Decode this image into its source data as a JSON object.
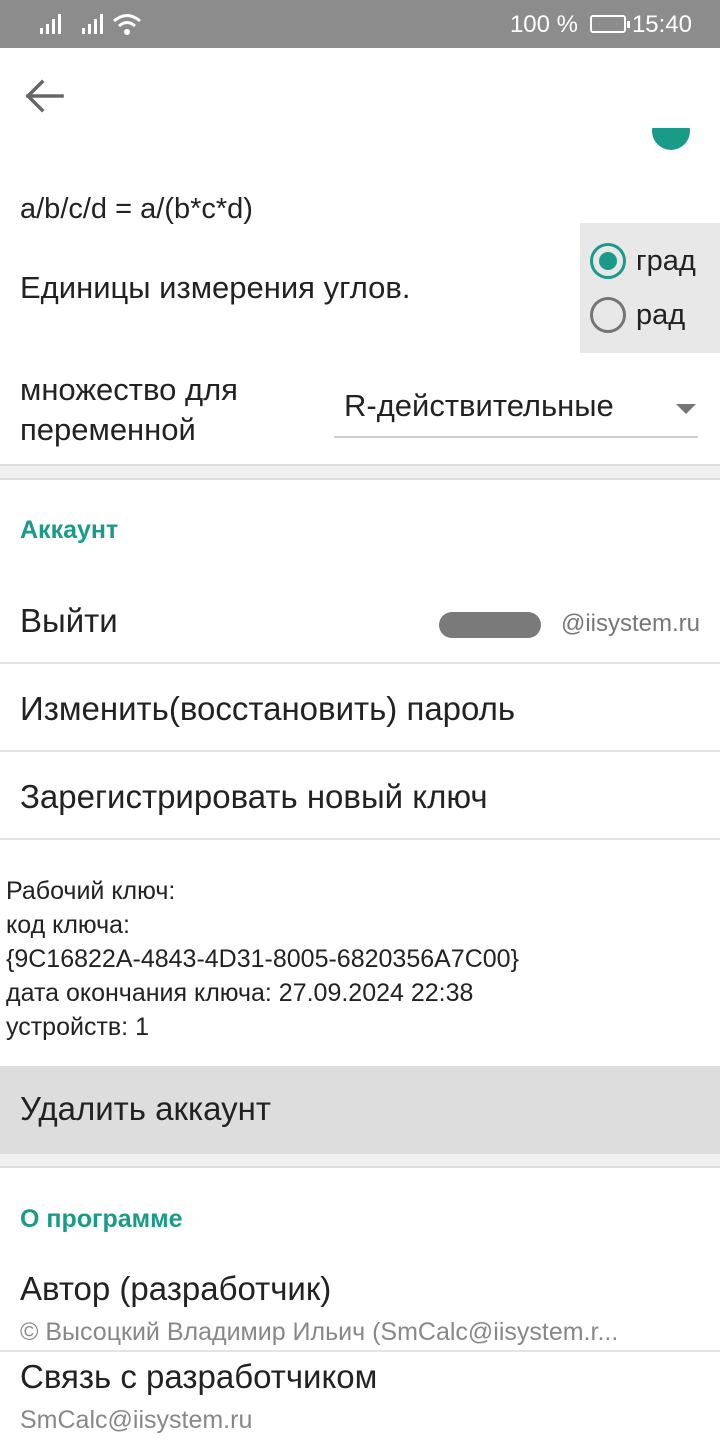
{
  "status_bar": {
    "battery_percent": "100 %",
    "time": "15:40"
  },
  "settings": {
    "formula_text": "a/b/c/d = a/(b*c*d)",
    "angle_units": {
      "label": "Единицы измерения углов.",
      "options": [
        {
          "label": "град",
          "selected": true
        },
        {
          "label": "рад",
          "selected": false
        }
      ]
    },
    "variable_set": {
      "label": "множество для переменной",
      "value": "R-действительные"
    }
  },
  "account": {
    "header": "Аккаунт",
    "logout_label": "Выйти",
    "email_suffix": "@iisystem.ru",
    "change_password_label": "Изменить(восстановить) пароль",
    "register_key_label": "Зарегистрировать новый ключ",
    "key_info": {
      "title": "Рабочий ключ:",
      "code_label": "код ключа:",
      "code": "{9C16822A-4843-4D31-8005-6820356A7C00}",
      "expiry": "дата окончания ключа: 27.09.2024 22:38",
      "devices": "устройств: 1"
    },
    "delete_label": "Удалить аккаунт"
  },
  "about": {
    "header": "О программе",
    "author_label": "Автор (разработчик)",
    "author_value": "© Высоцкий Владимир Ильич (SmCalc@iisystem.r...",
    "contact_label": "Связь с разработчиком",
    "contact_value": "SmCalc@iisystem.ru"
  },
  "colors": {
    "accent": "#1a9a89",
    "status_bar": "#8c8c8c"
  }
}
